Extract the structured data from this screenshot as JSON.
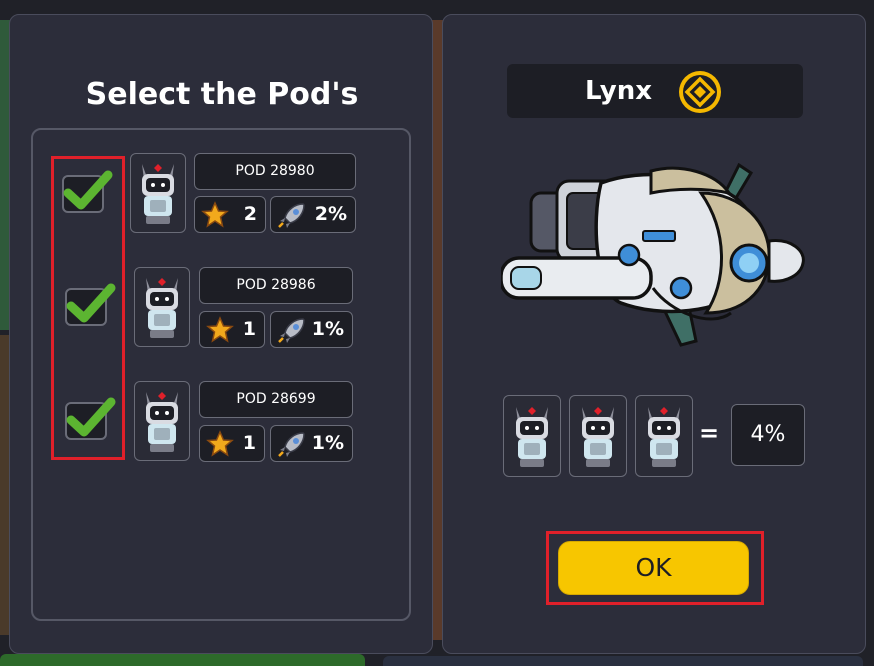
{
  "left_panel": {
    "title": "Select the Pod's",
    "pods": [
      {
        "name": "POD 28980",
        "stars": "2",
        "boost": "2%",
        "checked": true
      },
      {
        "name": "POD 28986",
        "stars": "1",
        "boost": "1%",
        "checked": true
      },
      {
        "name": "POD 28699",
        "stars": "1",
        "boost": "1%",
        "checked": true
      }
    ]
  },
  "right_panel": {
    "ship_name": "Lynx",
    "equals": "=",
    "result": "4%",
    "ok_label": "OK"
  },
  "icons": {
    "check": "check-icon",
    "star": "star-icon",
    "rocket": "rocket-icon",
    "coin": "coin-icon",
    "robot": "robot-pod-icon",
    "spaceship": "spaceship-icon"
  },
  "colors": {
    "panel_bg": "#2c2d3a",
    "accent_yellow": "#f7c600",
    "check_green": "#5cb531",
    "highlight_red": "#e0202a"
  }
}
